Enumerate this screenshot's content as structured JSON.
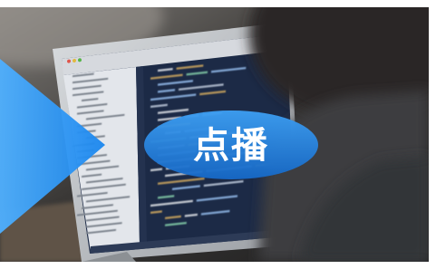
{
  "banner": {
    "label": "点播"
  },
  "colors": {
    "triangle_light": "#4fb0ff",
    "triangle_dark": "#1a86ee",
    "ellipse_top": "#3d9ff3",
    "ellipse_bottom": "#1668c6",
    "label_text": "#ffffff",
    "code_background": "#1c2a46"
  }
}
